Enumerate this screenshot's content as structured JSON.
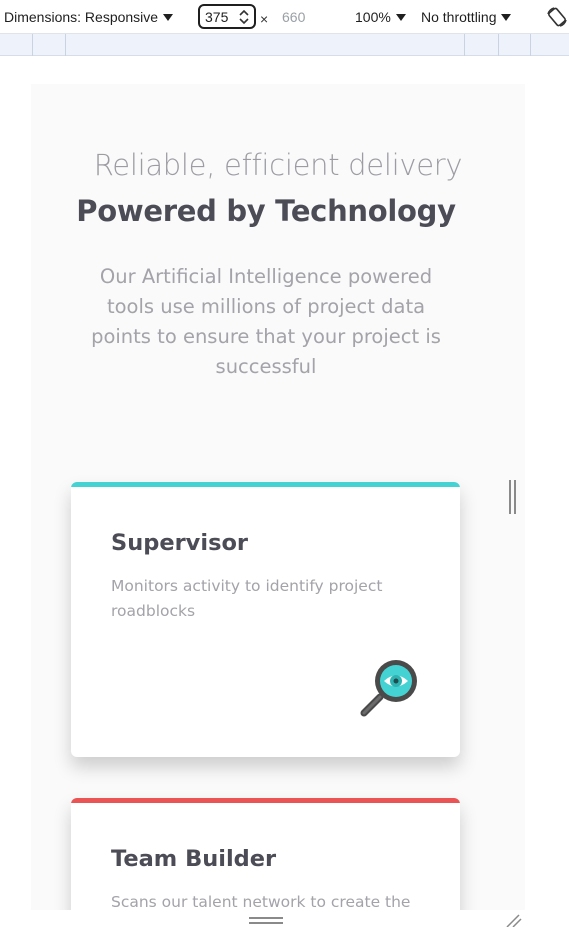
{
  "devtools": {
    "dimensions_label": "Dimensions: Responsive",
    "width_value": "375",
    "times_symbol": "×",
    "height_placeholder": "660",
    "zoom_label": "100%",
    "throttling_label": "No throttling",
    "rotate_icon": "rotate-device-icon"
  },
  "hero": {
    "line1": "Reliable, efficient delivery",
    "line2": "Powered by Technology",
    "description": "Our Artificial Intelligence powered tools use millions of project data points to ensure that your project is successful"
  },
  "cards": [
    {
      "title": "Supervisor",
      "description": "Monitors activity to identify project roadblocks",
      "accent_color": "#44d3d2",
      "icon": "magnifier-eye-icon"
    },
    {
      "title": "Team Builder",
      "description": "Scans our talent network to create the",
      "accent_color": "#ea5454",
      "icon": "team-builder-icon"
    }
  ],
  "colors": {
    "page_background": "#fafafa",
    "heading_dark": "#4c4c57",
    "heading_light": "#9c9ca3",
    "body_text": "#a3a3a9"
  }
}
